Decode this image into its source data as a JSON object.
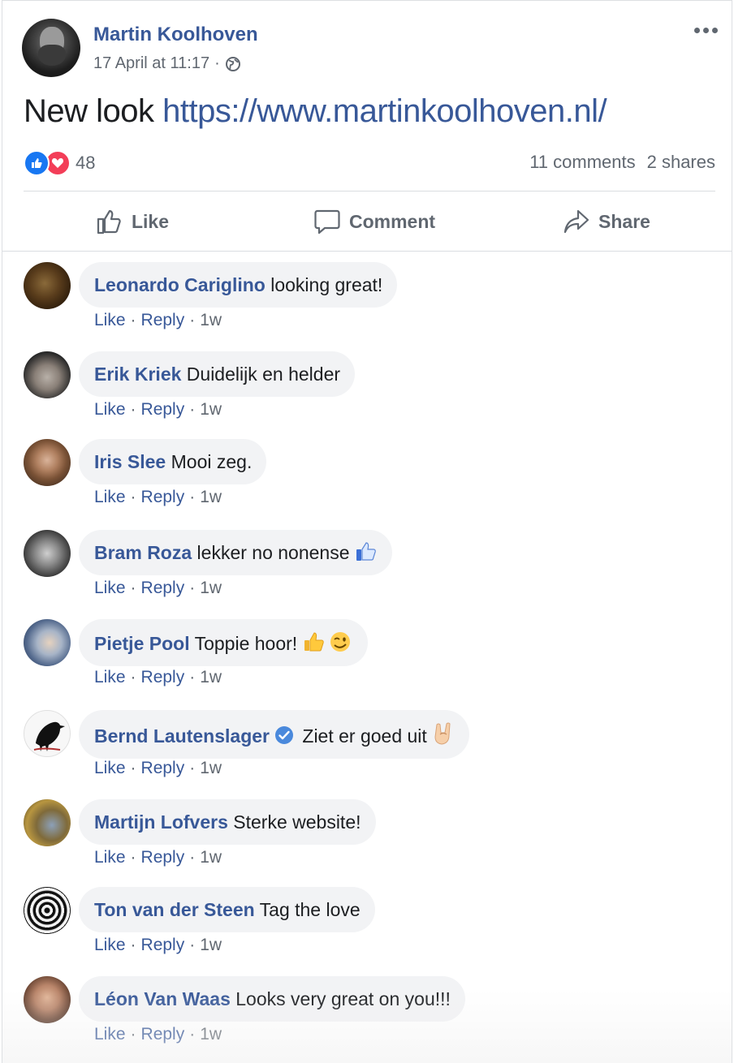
{
  "post": {
    "author": "Martin Koolhoven",
    "timestamp": "17 April at 11:17",
    "separator": "·",
    "privacy_icon": "globe-icon",
    "text": "New look",
    "link": "https://www.martinkoolhoven.nl/",
    "reaction_count": "48",
    "comments_count": "11 comments",
    "shares_count": "2 shares"
  },
  "actions": {
    "like": "Like",
    "comment": "Comment",
    "share": "Share"
  },
  "comment_actions": {
    "like": "Like",
    "reply": "Reply",
    "dot": "·"
  },
  "comments": [
    {
      "name": "Leonardo Cariglino",
      "text": "looking great!",
      "time": "1w"
    },
    {
      "name": "Erik Kriek",
      "text": "Duidelijk en helder",
      "time": "1w"
    },
    {
      "name": "Iris Slee",
      "text": "Mooi zeg.",
      "time": "1w"
    },
    {
      "name": "Bram Roza",
      "text": "lekker no nonense",
      "time": "1w",
      "emoji": "thumbs-up-icon"
    },
    {
      "name": "Pietje Pool",
      "text": "Toppie hoor!",
      "time": "1w",
      "emoji": "thumbs-up-wink-icon"
    },
    {
      "name": "Bernd Lautenslager",
      "text": "Ziet er goed uit",
      "time": "1w",
      "verified": true,
      "emoji": "rock-hand-icon"
    },
    {
      "name": "Martijn Lofvers",
      "text": "Sterke website!",
      "time": "1w"
    },
    {
      "name": "Ton van der Steen",
      "text": "Tag the love",
      "time": "1w"
    },
    {
      "name": "Léon Van Waas",
      "text": "Looks very great on you!!!",
      "time": "1w"
    }
  ],
  "colors": {
    "link": "#385898",
    "like_reaction": "#1877f2",
    "love_reaction": "#f33e58",
    "bubble": "#f2f3f5",
    "muted": "#606770"
  }
}
